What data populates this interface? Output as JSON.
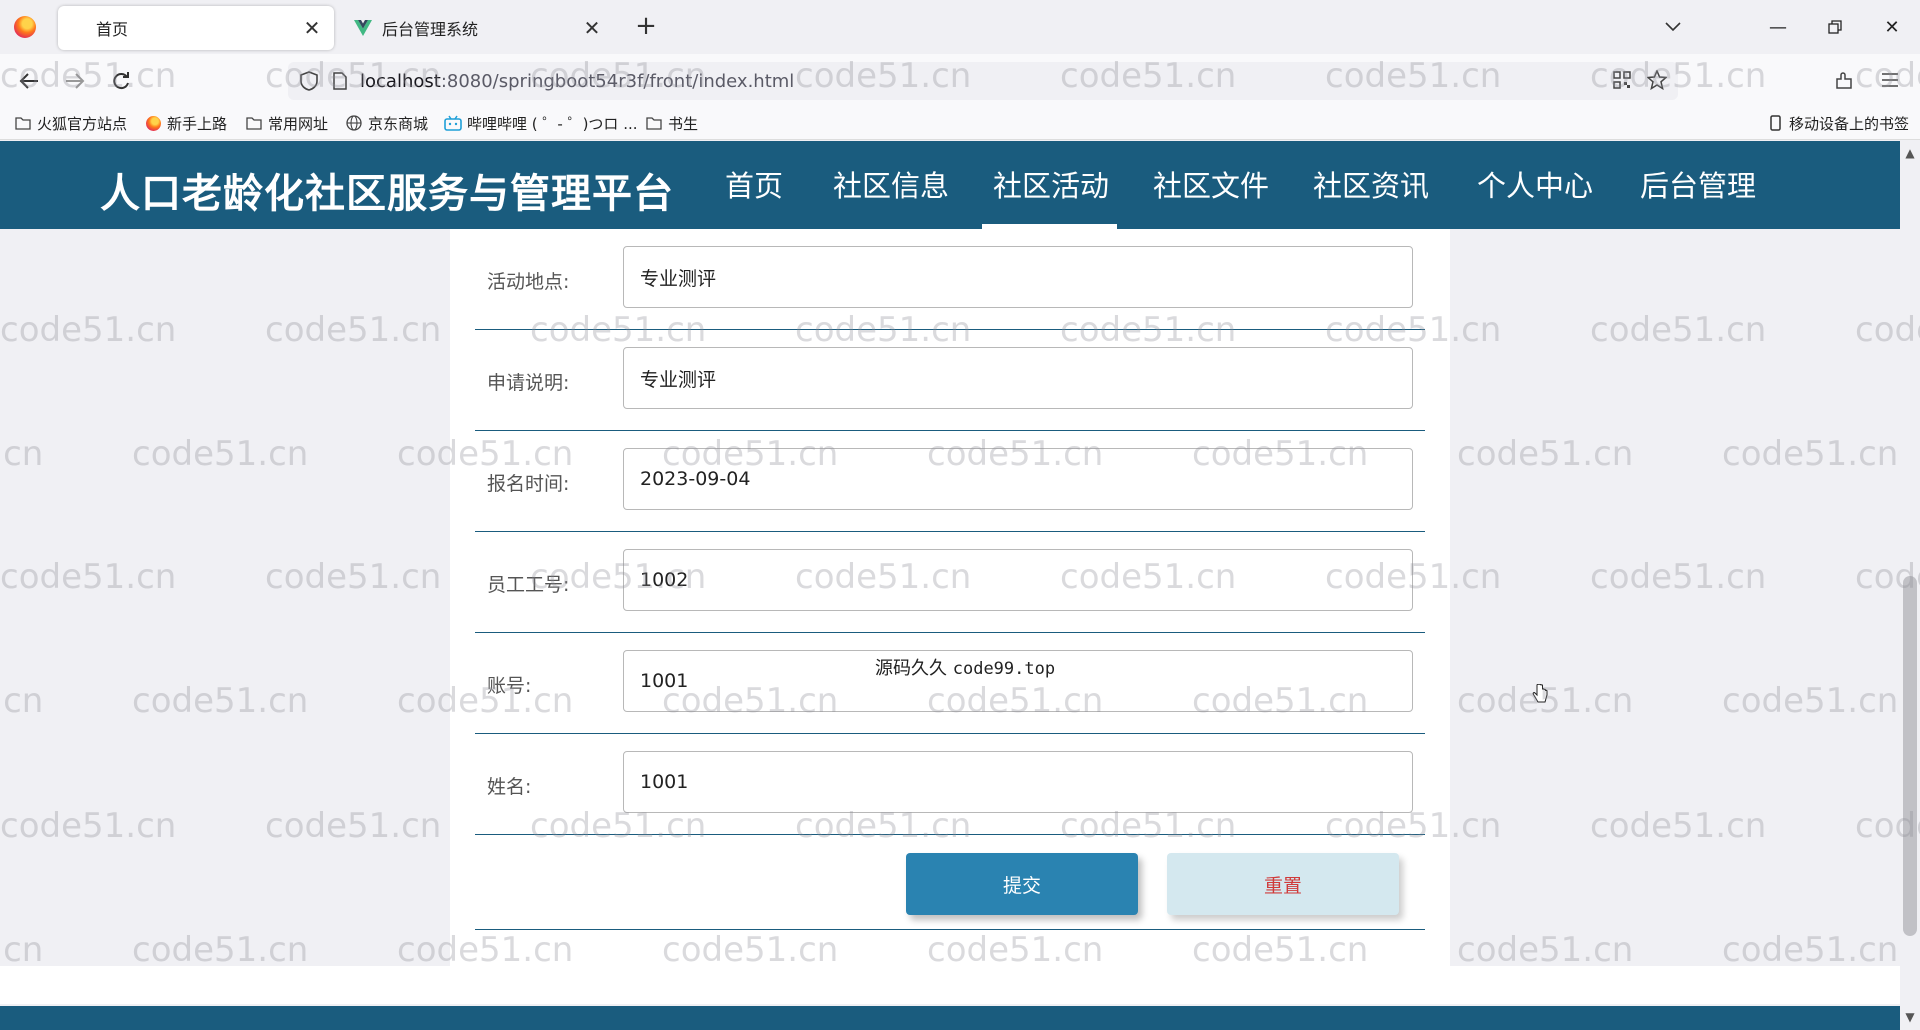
{
  "browser": {
    "tabs": [
      {
        "title": "首页",
        "active": true
      },
      {
        "title": "后台管理系统",
        "active": false
      }
    ],
    "url_host": "localhost",
    "url_rest": ":8080/springboot54r3f/front/index.html",
    "bookmarks": [
      {
        "label": "火狐官方站点",
        "icon": "folder-icon"
      },
      {
        "label": "新手上路",
        "icon": "firefox-icon"
      },
      {
        "label": "常用网址",
        "icon": "folder-icon"
      },
      {
        "label": "京东商城",
        "icon": "globe-icon"
      },
      {
        "label": "哔哩哔哩 ( ゜- ゜)つロ ...",
        "icon": "bilibili-icon"
      },
      {
        "label": "书生",
        "icon": "folder-icon"
      }
    ],
    "mobile_bookmarks": "移动设备上的书签"
  },
  "site": {
    "title": "人口老龄化社区服务与管理平台",
    "menu": [
      "首页",
      "社区信息",
      "社区活动",
      "社区文件",
      "社区资讯",
      "个人中心",
      "后台管理"
    ],
    "active_menu": "社区活动"
  },
  "form": {
    "fields": [
      {
        "label": "活动地点:",
        "value": "专业测评"
      },
      {
        "label": "申请说明:",
        "value": "专业测评"
      },
      {
        "label": "报名时间:",
        "value": "2023-09-04"
      },
      {
        "label": "员工工号:",
        "value": "1002"
      },
      {
        "label": "账号:",
        "value": "1001"
      },
      {
        "label": "姓名:",
        "value": "1001"
      }
    ],
    "submit_label": "提交",
    "reset_label": "重置"
  },
  "overlay_note": {
    "cn": "源码久久",
    "en": "code99.top"
  },
  "watermark_text": "code51.cn",
  "colors": {
    "brand": "#1a5c7e",
    "submit": "#2a83b1",
    "reset_bg": "#d4e8ef",
    "reset_text": "#d03a3a"
  }
}
